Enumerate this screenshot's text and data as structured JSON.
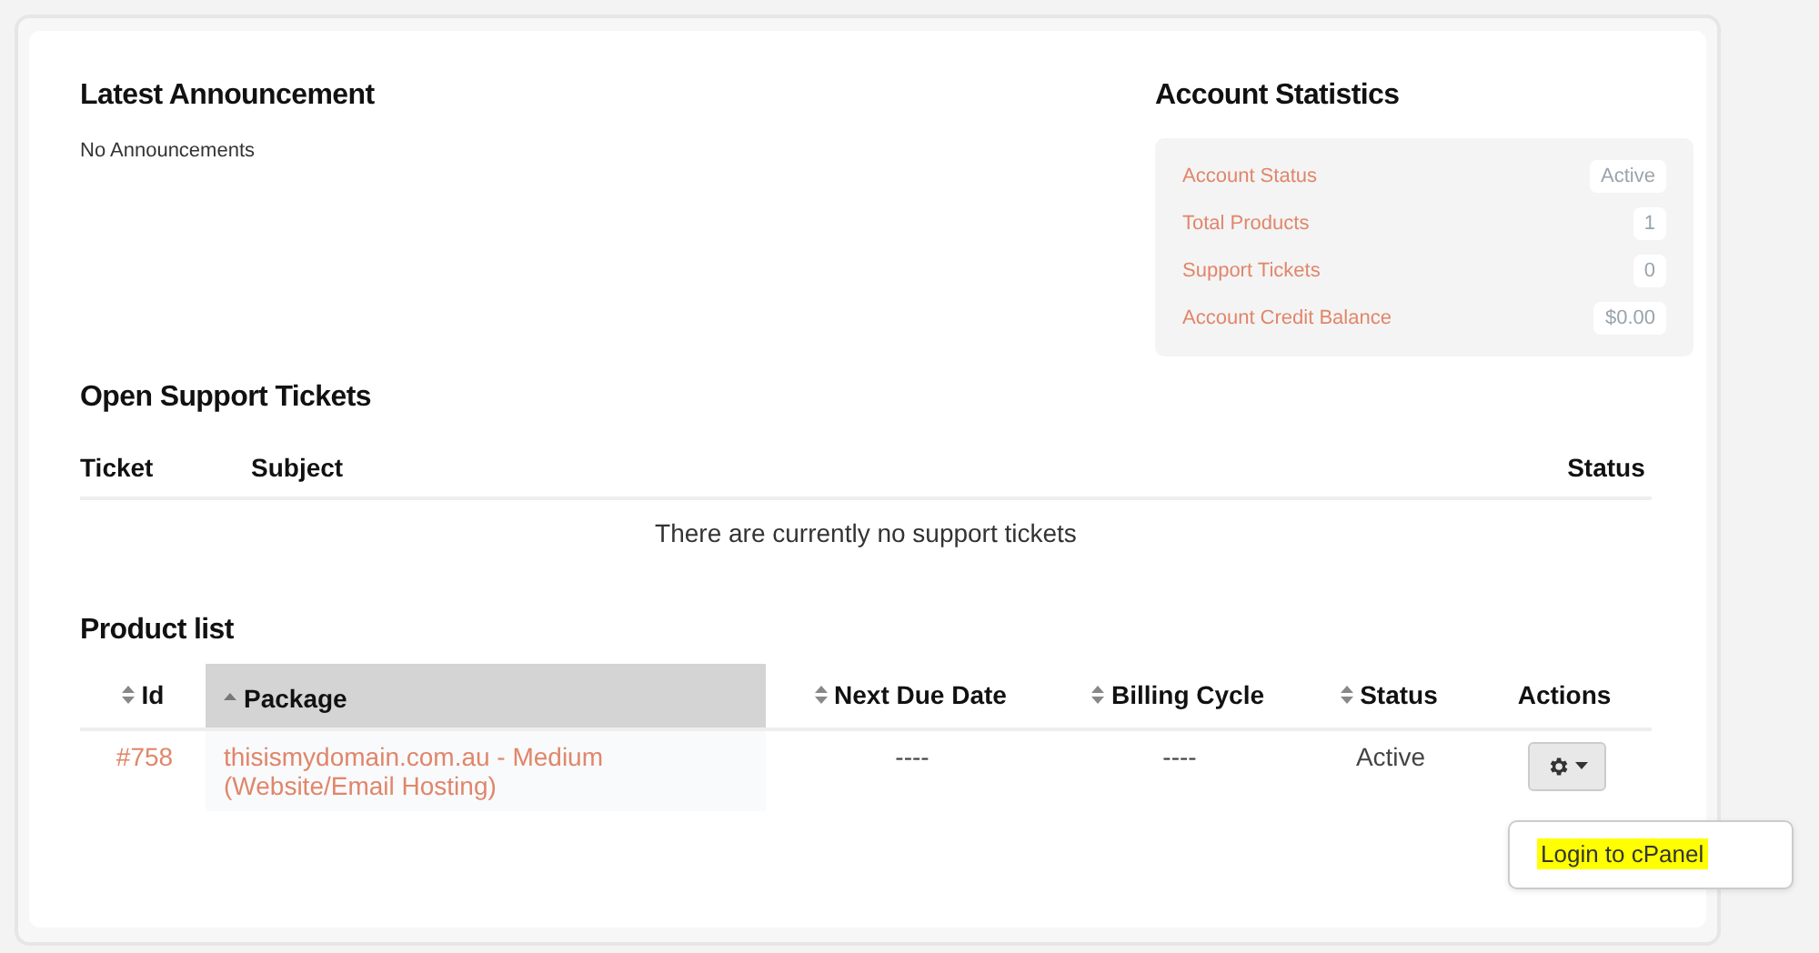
{
  "announcements": {
    "title": "Latest Announcement",
    "message": "No Announcements"
  },
  "account_statistics": {
    "title": "Account Statistics",
    "items": [
      {
        "label": "Account Status",
        "value": "Active"
      },
      {
        "label": "Total Products",
        "value": "1"
      },
      {
        "label": "Support Tickets",
        "value": "0"
      },
      {
        "label": "Account Credit Balance",
        "value": "$0.00"
      }
    ]
  },
  "support_tickets": {
    "title": "Open Support Tickets",
    "columns": [
      {
        "label": "Ticket"
      },
      {
        "label": "Subject"
      },
      {
        "label": "Status"
      }
    ],
    "empty_message": "There are currently no support tickets"
  },
  "product_list": {
    "title": "Product list",
    "columns": [
      {
        "label": "Id",
        "sortable": true,
        "selected": false
      },
      {
        "label": "Package",
        "sortable": true,
        "selected": true
      },
      {
        "label": "Next Due Date",
        "sortable": true,
        "selected": false
      },
      {
        "label": "Billing Cycle",
        "sortable": true,
        "selected": false
      },
      {
        "label": "Status",
        "sortable": true,
        "selected": false
      },
      {
        "label": "Actions",
        "sortable": false,
        "selected": false
      }
    ],
    "rows": [
      {
        "id": "#758",
        "package": "thisismydomain.com.au - Medium (Website/Email Hosting)",
        "next_due_date": "----",
        "billing_cycle": "----",
        "status": "Active"
      }
    ],
    "actions_menu": {
      "items": [
        {
          "label": "Login to cPanel",
          "highlighted": true
        }
      ]
    }
  }
}
